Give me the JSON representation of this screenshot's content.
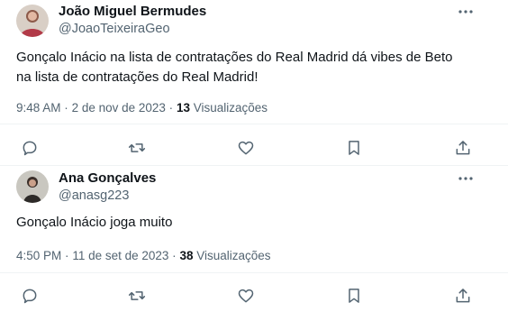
{
  "tweets": [
    {
      "name": "João Miguel Bermudes",
      "handle": "@JoaoTeixeiraGeo",
      "text_line1": "Gonçalo Inácio na lista de contratações do Real Madrid dá vibes de Beto",
      "text_line2": "na lista de contratações do Real Madrid!",
      "time": "9:48 AM",
      "sep": "·",
      "date": "2 de nov de 2023",
      "views_count": "13",
      "views_label": "Visualizações",
      "more_icon": "more-horizontal-icon"
    },
    {
      "name": "Ana Gonçalves",
      "handle": "@anasg223",
      "text_line1": "Gonçalo Inácio joga muito",
      "time": "4:50 PM",
      "sep": "·",
      "date": "11 de set de 2023",
      "views_count": "38",
      "views_label": "Visualizações",
      "more_icon": "more-horizontal-icon"
    }
  ],
  "actions": [
    "reply-icon",
    "retweet-icon",
    "like-icon",
    "bookmark-icon",
    "share-icon"
  ],
  "colors": {
    "text": "#0f1419",
    "secondary": "#536471",
    "divider": "#eff3f4"
  }
}
